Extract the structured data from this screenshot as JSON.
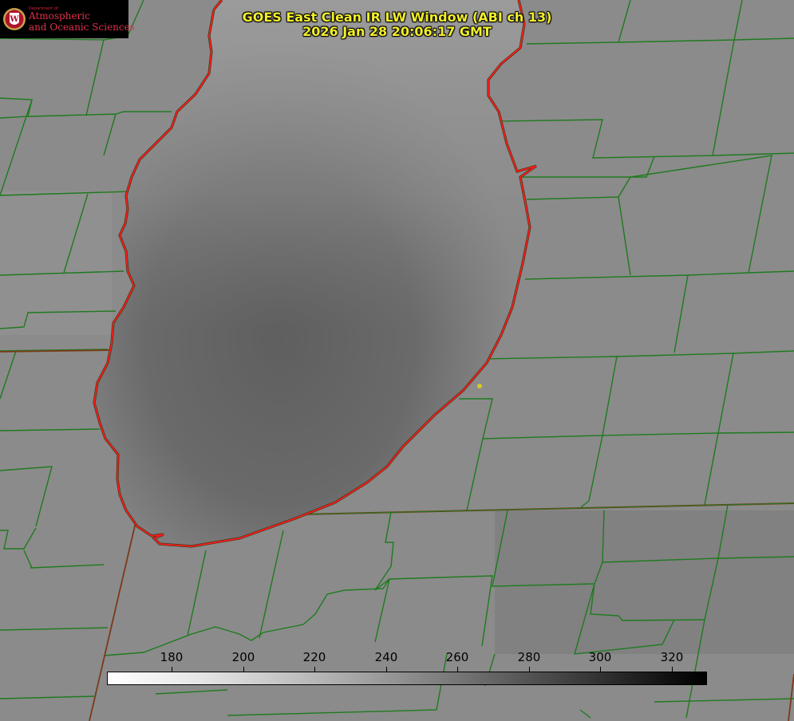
{
  "map": {
    "title_line1": "GOES East Clean IR LW Window (ABI ch 13)",
    "title_line2": "2026 Jan 28 20:06:17 GMT",
    "logo": {
      "small": "Department of",
      "line1": "Atmospheric",
      "line2": "and Oceanic Sciences",
      "seal_letter": "W"
    },
    "colorbar": {
      "ticks": [
        "180",
        "200",
        "220",
        "240",
        "260",
        "280",
        "300",
        "320"
      ]
    },
    "colors": {
      "county_lines": "#1f7a1f",
      "state_lines": "#7a3a1a",
      "lake_shore": "#ff1a1a",
      "marker": "#d6c72a",
      "title": "#f2ef2a"
    }
  }
}
